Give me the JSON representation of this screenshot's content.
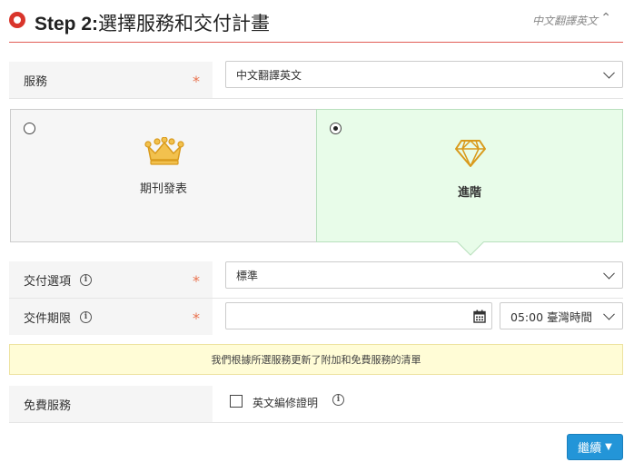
{
  "header": {
    "step_label": "Step 2:",
    "title": "選擇服務和交付計畫",
    "summary": "中文翻譯英文",
    "collapse_glyph": "⌃"
  },
  "service": {
    "label": "服務",
    "required": "*",
    "selected": "中文翻譯英文"
  },
  "plans": [
    {
      "name": "期刊發表",
      "icon": "crown-icon",
      "selected": false
    },
    {
      "name": "進階",
      "icon": "diamond-icon",
      "selected": true
    }
  ],
  "delivery": {
    "label": "交付選項",
    "required": "*",
    "selected": "標準"
  },
  "deadline": {
    "label": "交件期限",
    "required": "*",
    "date_value": "",
    "time_selected": "05:00 臺灣時間"
  },
  "notice": "我們根據所選服務更新了附加和免費服務的清單",
  "free_services": {
    "label": "免費服務",
    "option": "英文編修證明",
    "checked": false
  },
  "continue_label": "繼續",
  "colors": {
    "accent": "#d9352b",
    "selected_card": "#e8fce9",
    "button": "#2395d8",
    "notice_bg": "#fffcd6",
    "gold": "#e5a92a"
  }
}
